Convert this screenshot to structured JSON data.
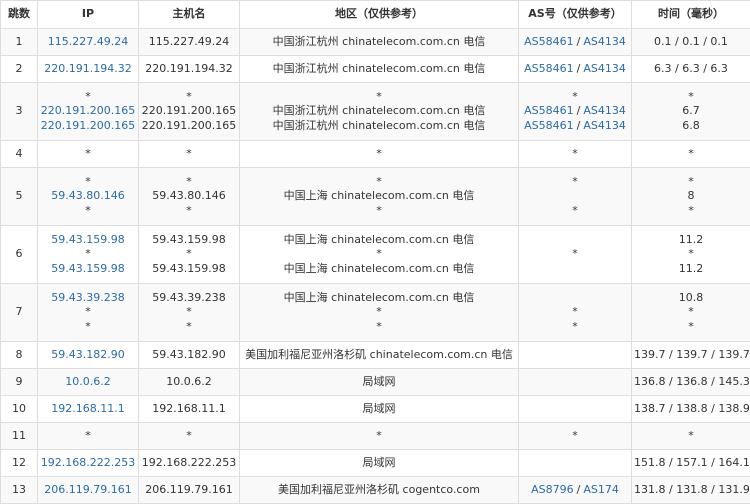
{
  "headers": [
    "跳数",
    "IP",
    "主机名",
    "地区（仅供参考）",
    "AS号（仅供参考）",
    "时间（毫秒）"
  ],
  "rows": [
    {
      "hop": "1",
      "ip": [
        "115.227.49.24"
      ],
      "host": [
        "115.227.49.24"
      ],
      "region": [
        "中国浙江杭州 chinatelecom.com.cn 电信"
      ],
      "asn": [
        [
          "AS58461",
          "AS4134"
        ]
      ],
      "time": [
        "0.1 / 0.1 / 0.1"
      ]
    },
    {
      "hop": "2",
      "ip": [
        "220.191.194.32"
      ],
      "host": [
        "220.191.194.32"
      ],
      "region": [
        "中国浙江杭州 chinatelecom.com.cn 电信"
      ],
      "asn": [
        [
          "AS58461",
          "AS4134"
        ]
      ],
      "time": [
        "6.3 / 6.3 / 6.3"
      ]
    },
    {
      "hop": "3",
      "ip": [
        "*",
        "220.191.200.165",
        "220.191.200.165"
      ],
      "host": [
        "*",
        "220.191.200.165",
        "220.191.200.165"
      ],
      "region": [
        "*",
        "中国浙江杭州 chinatelecom.com.cn 电信",
        "中国浙江杭州 chinatelecom.com.cn 电信"
      ],
      "asn": [
        "*",
        [
          "AS58461",
          "AS4134"
        ],
        [
          "AS58461",
          "AS4134"
        ]
      ],
      "time": [
        "*",
        "6.7",
        "6.8"
      ]
    },
    {
      "hop": "4",
      "ip": [
        "*"
      ],
      "host": [
        "*"
      ],
      "region": [
        "*"
      ],
      "asn": [
        "*"
      ],
      "time": [
        "*"
      ]
    },
    {
      "hop": "5",
      "ip": [
        "*",
        "59.43.80.146",
        "*"
      ],
      "host": [
        "*",
        "59.43.80.146",
        "*"
      ],
      "region": [
        "*",
        "中国上海 chinatelecom.com.cn 电信",
        "*"
      ],
      "asn": [
        "*",
        "",
        "*"
      ],
      "time": [
        "*",
        "8",
        "*"
      ]
    },
    {
      "hop": "6",
      "ip": [
        "59.43.159.98",
        "*",
        "59.43.159.98"
      ],
      "host": [
        "59.43.159.98",
        "*",
        "59.43.159.98"
      ],
      "region": [
        "中国上海 chinatelecom.com.cn 电信",
        "*",
        "中国上海 chinatelecom.com.cn 电信"
      ],
      "asn": [
        "",
        "*",
        ""
      ],
      "time": [
        "11.2",
        "*",
        "11.2"
      ]
    },
    {
      "hop": "7",
      "ip": [
        "59.43.39.238",
        "*",
        "*"
      ],
      "host": [
        "59.43.39.238",
        "*",
        "*"
      ],
      "region": [
        "中国上海 chinatelecom.com.cn 电信",
        "*",
        "*"
      ],
      "asn": [
        "",
        "*",
        "*"
      ],
      "time": [
        "10.8",
        "*",
        "*"
      ]
    },
    {
      "hop": "8",
      "ip": [
        "59.43.182.90"
      ],
      "host": [
        "59.43.182.90"
      ],
      "region": [
        "美国加利福尼亚州洛杉矶 chinatelecom.com.cn 电信"
      ],
      "asn": [
        ""
      ],
      "time": [
        "139.7 / 139.7 / 139.7"
      ]
    },
    {
      "hop": "9",
      "ip": [
        "10.0.6.2"
      ],
      "host": [
        "10.0.6.2"
      ],
      "region": [
        "局域网"
      ],
      "asn": [
        ""
      ],
      "time": [
        "136.8 / 136.8 / 145.3"
      ]
    },
    {
      "hop": "10",
      "ip": [
        "192.168.11.1"
      ],
      "host": [
        "192.168.11.1"
      ],
      "region": [
        "局域网"
      ],
      "asn": [
        ""
      ],
      "time": [
        "138.7 / 138.8 / 138.9"
      ]
    },
    {
      "hop": "11",
      "ip": [
        "*"
      ],
      "host": [
        "*"
      ],
      "region": [
        "*"
      ],
      "asn": [
        "*"
      ],
      "time": [
        "*"
      ]
    },
    {
      "hop": "12",
      "ip": [
        "192.168.222.253"
      ],
      "host": [
        "192.168.222.253"
      ],
      "region": [
        "局域网"
      ],
      "asn": [
        ""
      ],
      "time": [
        "151.8 / 157.1 / 164.1"
      ]
    },
    {
      "hop": "13",
      "ip": [
        "206.119.79.161"
      ],
      "host": [
        "206.119.79.161"
      ],
      "region": [
        "美国加利福尼亚州洛杉矶 cogentco.com"
      ],
      "asn": [
        [
          "AS8796",
          "AS174"
        ]
      ],
      "time": [
        "131.8 / 131.8 / 131.9"
      ]
    }
  ]
}
